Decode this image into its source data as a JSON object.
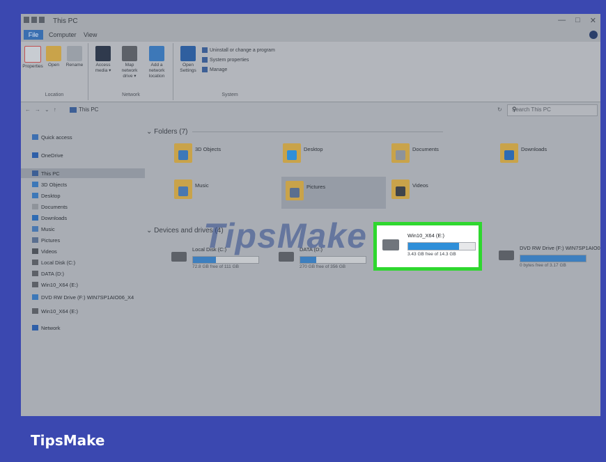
{
  "window": {
    "title": "This PC",
    "controls": [
      "—",
      "□",
      "✕"
    ]
  },
  "tabs": [
    "File",
    "Computer",
    "View"
  ],
  "ribbon": {
    "location_group": {
      "label": "Location",
      "buttons": [
        {
          "label": "Properties",
          "icon": "properties-icon"
        },
        {
          "label": "Open",
          "icon": "open-icon"
        },
        {
          "label": "Rename",
          "icon": "rename-icon"
        }
      ]
    },
    "network_group": {
      "label": "Network",
      "buttons": [
        {
          "label": "Access media ▾",
          "icon": "access-media-icon"
        },
        {
          "label": "Map network drive ▾",
          "icon": "map-network-drive-icon"
        },
        {
          "label": "Add a network location",
          "icon": "add-network-location-icon"
        }
      ]
    },
    "system_group": {
      "label": "System",
      "open_settings": "Open Settings",
      "items": [
        "Uninstall or change a program",
        "System properties",
        "Manage"
      ]
    }
  },
  "address": {
    "path": "This PC",
    "search_placeholder": "Search This PC"
  },
  "sidebar": [
    {
      "label": "Quick access",
      "icon": "star-icon",
      "color": "#3d6fb0"
    },
    {
      "label": "OneDrive",
      "icon": "cloud-icon",
      "color": "#2e5fa8"
    },
    {
      "label": "This PC",
      "icon": "computer-icon",
      "color": "#3d5f95",
      "selected": true
    },
    {
      "label": "3D Objects",
      "icon": "cube-icon",
      "color": "#3d78b8"
    },
    {
      "label": "Desktop",
      "icon": "desktop-icon",
      "color": "#3d78b8"
    },
    {
      "label": "Documents",
      "icon": "document-icon",
      "color": "#8e939a"
    },
    {
      "label": "Downloads",
      "icon": "download-icon",
      "color": "#2f6bb3"
    },
    {
      "label": "Music",
      "icon": "music-icon",
      "color": "#4a78b0"
    },
    {
      "label": "Pictures",
      "icon": "picture-icon",
      "color": "#5a6f8f"
    },
    {
      "label": "Videos",
      "icon": "video-icon",
      "color": "#4f545c"
    },
    {
      "label": "Local Disk (C:)",
      "icon": "disk-icon",
      "color": "#5d6168"
    },
    {
      "label": "DATA (D:)",
      "icon": "disk-icon",
      "color": "#5d6168"
    },
    {
      "label": "Win10_X64 (E:)",
      "icon": "usb-icon",
      "color": "#5d6168"
    },
    {
      "label": "DVD RW Drive (F:) WIN7SP1AIO06_X4",
      "icon": "dvd-icon",
      "color": "#3d78b8"
    },
    {
      "label": "Win10_X64 (E:)",
      "icon": "usb-icon",
      "color": "#5d6168"
    },
    {
      "label": "Network",
      "icon": "network-icon",
      "color": "#2e5fa8"
    }
  ],
  "folders_section": {
    "title": "Folders (7)"
  },
  "folders": [
    {
      "name": "3D Objects",
      "icon": "cube-folder-icon",
      "inner_color": "#3d78b8"
    },
    {
      "name": "Desktop",
      "icon": "desktop-folder-icon",
      "inner_color": "#2f8fd9"
    },
    {
      "name": "Documents",
      "icon": "documents-folder-icon",
      "inner_color": "#8e939a"
    },
    {
      "name": "Downloads",
      "icon": "downloads-folder-icon",
      "inner_color": "#2f6bb3"
    },
    {
      "name": "Music",
      "icon": "music-folder-icon",
      "inner_color": "#4a78b0"
    },
    {
      "name": "Pictures",
      "icon": "pictures-folder-icon",
      "inner_color": "#5a6f8f",
      "selected": true
    },
    {
      "name": "Videos",
      "icon": "videos-folder-icon",
      "inner_color": "#3f444b"
    }
  ],
  "devices_section": {
    "title": "Devices and drives (4)"
  },
  "drives": [
    {
      "name": "Local Disk (C:)",
      "free": "72.8 GB free of 111 GB",
      "used_fraction": 0.35,
      "icon": "windows-disk-icon"
    },
    {
      "name": "DATA (D:)",
      "free": "270 GB free of 356 GB",
      "used_fraction": 0.24,
      "icon": "disk-icon"
    },
    {
      "name": "Win10_X64 (E:)",
      "free": "3.43 GB free of 14.3 GB",
      "used_fraction": 0.76,
      "icon": "usb-drive-icon",
      "highlighted": true
    },
    {
      "name": "DVD RW Drive (F:) WIN7SP1AIO06_X4",
      "free": "0 bytes free of 3.17 GB",
      "used_fraction": 1.0,
      "icon": "dvd-drive-icon"
    }
  ],
  "watermark": "TipsMake",
  "brand": "TipsMake",
  "colors": {
    "highlight": "#2fd72f",
    "background": "#3b48b0"
  }
}
